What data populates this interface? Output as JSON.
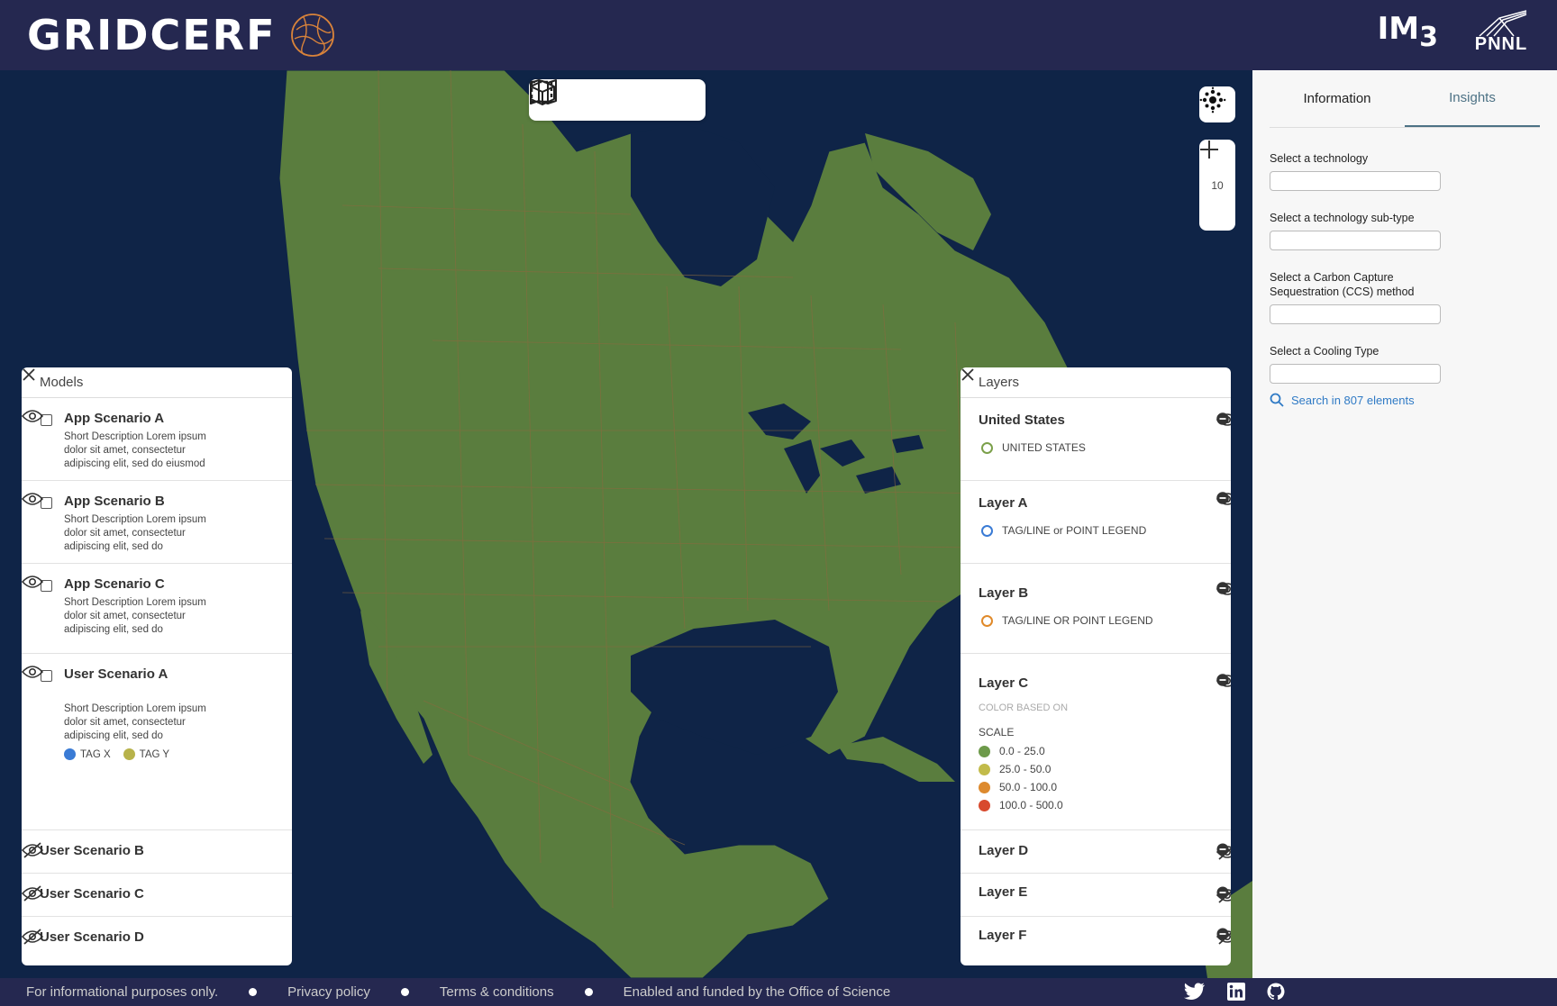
{
  "header": {
    "brand": "GRIDCERF",
    "im3_label": "IM",
    "im3_sub": "3",
    "pnnl_label": "PNNL"
  },
  "map": {
    "zoom_level": "10",
    "colors": {
      "water": "#0f2447",
      "land": "#5a7d3e",
      "borders": "#8a6a3e"
    }
  },
  "sidebar": {
    "tabs": [
      {
        "label": "Information"
      },
      {
        "label": "Insights"
      }
    ],
    "fields": [
      {
        "label": "Select a technology"
      },
      {
        "label": "Select a technology sub-type"
      },
      {
        "label": "Select a Carbon Capture Sequestration (CCS) method"
      },
      {
        "label": "Select a Cooling Type"
      }
    ],
    "search_link": "Search in 807 elements"
  },
  "models": {
    "title": "Models",
    "items": [
      {
        "title": "App Scenario A",
        "desc": "Short Description Lorem ipsum dolor sit amet, consectetur adipiscing elit, sed do eiusmod"
      },
      {
        "title": "App Scenario B",
        "desc": "Short Description Lorem ipsum dolor sit amet, consectetur adipiscing elit, sed do"
      },
      {
        "title": "App Scenario C",
        "desc": "Short Description Lorem ipsum dolor sit amet, consectetur adipiscing elit, sed do"
      },
      {
        "title": "User Scenario A",
        "desc": "Short Description Lorem ipsum dolor sit amet, consectetur adipiscing elit, sed do",
        "tags": [
          "TAG X",
          "TAG Y"
        ]
      },
      {
        "title": "User Scenario B"
      },
      {
        "title": "User Scenario C"
      },
      {
        "title": "User Scenario D"
      }
    ],
    "tag_colors": [
      "#3a7bd5",
      "#b7b24a"
    ]
  },
  "layers": {
    "title": "Layers",
    "items": [
      {
        "title": "United States",
        "legend": "UNITED STATES",
        "ring_color": "#7ba04a"
      },
      {
        "title": "Layer A",
        "legend": "TAG/LINE or POINT LEGEND",
        "ring_color": "#3a7bd5"
      },
      {
        "title": "Layer B",
        "legend": "TAG/LINE OR POINT LEGEND",
        "ring_color": "#e08a2a"
      },
      {
        "title": "Layer C",
        "color_based_on": "COLOR BASED ON",
        "scale_label": "SCALE",
        "scale": [
          {
            "label": "0.0 - 25.0",
            "color": "#6d9a4a"
          },
          {
            "label": "25.0 - 50.0",
            "color": "#c2bb4a"
          },
          {
            "label": "50.0 - 100.0",
            "color": "#dd8a2e"
          },
          {
            "label": "100.0 - 500.0",
            "color": "#d84a2e"
          }
        ]
      },
      {
        "title": "Layer D"
      },
      {
        "title": "Layer E"
      },
      {
        "title": "Layer F"
      }
    ]
  },
  "footer": {
    "items": [
      "For informational purposes only.",
      "Privacy policy",
      "Terms & conditions",
      "Enabled and funded by the Office of Science"
    ]
  }
}
